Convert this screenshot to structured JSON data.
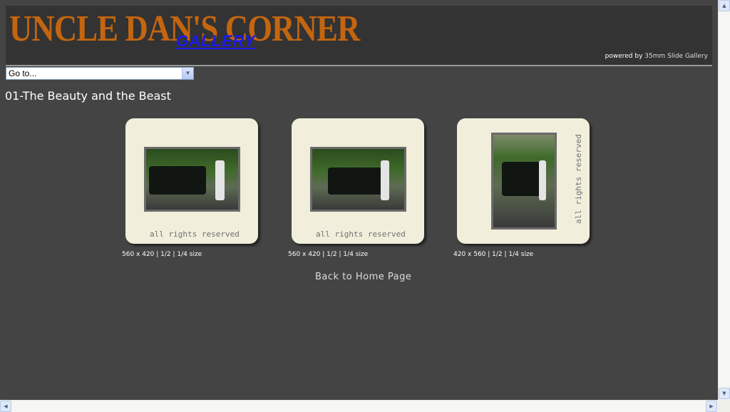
{
  "header": {
    "logo": "UNCLE DAN'S CORNER",
    "logo_sub": "GALLERY",
    "powered_prefix": "powered by ",
    "powered_link": "35mm Slide Gallery"
  },
  "nav": {
    "goto_value": "Go to..."
  },
  "album": {
    "title": "01-The Beauty and the Beast"
  },
  "slides": [
    {
      "rights": "all rights reserved",
      "dims": "560 x 420",
      "half": "1/2",
      "quarter": "1/4 size"
    },
    {
      "rights": "all rights reserved",
      "dims": "560 x 420",
      "half": "1/2",
      "quarter": "1/4 size"
    },
    {
      "rights": "all rights reserved",
      "dims": "420 x 560",
      "half": "1/2",
      "quarter": "1/4 size"
    }
  ],
  "separator": " | ",
  "back_link": "Back to Home Page",
  "icons": {
    "dropdown": "chevron-down-icon",
    "scroll_up": "arrow-up-icon",
    "scroll_down": "arrow-down-icon",
    "scroll_left": "arrow-left-icon",
    "scroll_right": "arrow-right-icon"
  },
  "colors": {
    "page_bg": "#444444",
    "header_bg": "#333333",
    "logo": "#c4650f",
    "logo_sub": "#1a1aee",
    "slide_mount": "#f1efdc"
  }
}
